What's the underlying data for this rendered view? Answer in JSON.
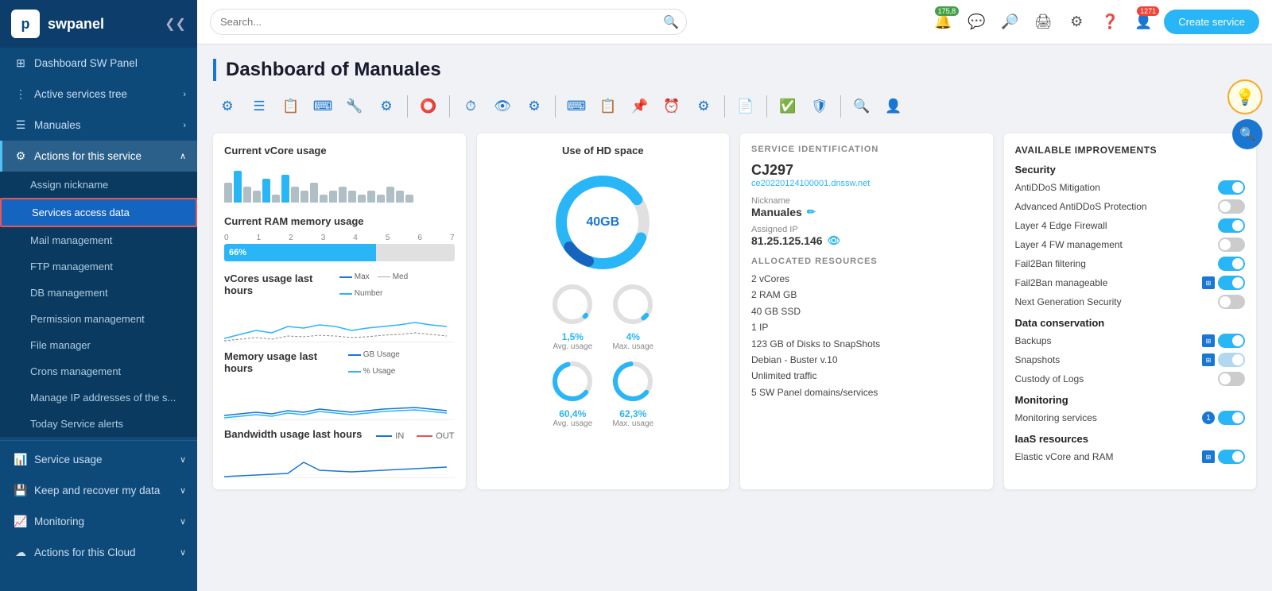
{
  "brand": {
    "logo_letter": "p",
    "name": "swpanel",
    "collapse_icon": "❮❮"
  },
  "sidebar": {
    "items": [
      {
        "id": "dashboard",
        "label": "Dashboard SW Panel",
        "icon": "⊞",
        "has_arrow": false
      },
      {
        "id": "active-services",
        "label": "Active services tree",
        "icon": "⋮",
        "has_arrow": true
      },
      {
        "id": "manuales",
        "label": "Manuales",
        "icon": "☰",
        "has_arrow": true,
        "expanded": true
      },
      {
        "id": "actions-service",
        "label": "Actions for this service",
        "icon": "⚙",
        "has_arrow": true,
        "active": true
      }
    ],
    "subitems": [
      {
        "id": "assign-nickname",
        "label": "Assign nickname"
      },
      {
        "id": "services-access-data",
        "label": "Services access data",
        "selected": true
      },
      {
        "id": "mail-management",
        "label": "Mail management"
      },
      {
        "id": "ftp-management",
        "label": "FTP management"
      },
      {
        "id": "db-management",
        "label": "DB management"
      },
      {
        "id": "permission-management",
        "label": "Permission management"
      },
      {
        "id": "file-manager",
        "label": "File manager"
      },
      {
        "id": "crons-management",
        "label": "Crons management"
      },
      {
        "id": "manage-ip",
        "label": "Manage IP addresses of the s..."
      },
      {
        "id": "today-alerts",
        "label": "Today Service alerts"
      }
    ],
    "bottom_items": [
      {
        "id": "service-usage",
        "label": "Service usage",
        "icon": "📊",
        "has_arrow": true
      },
      {
        "id": "keep-recover",
        "label": "Keep and recover my data",
        "icon": "💾",
        "has_arrow": true
      },
      {
        "id": "monitoring",
        "label": "Monitoring",
        "icon": "📈",
        "has_arrow": true
      },
      {
        "id": "actions-cloud",
        "label": "Actions for this Cloud",
        "icon": "☁",
        "has_arrow": true
      }
    ]
  },
  "topbar": {
    "search_placeholder": "Search...",
    "badges": {
      "green_count": "175,8",
      "red_count": "1271"
    },
    "create_btn": "Create service"
  },
  "page": {
    "title": "Dashboard of Manuales"
  },
  "toolbar": {
    "icons": [
      "⚙",
      "☰",
      "📋",
      "⌨",
      "🔧",
      "⚙",
      "⭕",
      "⏱",
      "👁",
      "⚙",
      "⌨",
      "📋",
      "📌",
      "⏰",
      "⚙",
      "📄",
      "✅",
      "🛡",
      "🔍",
      "👤"
    ]
  },
  "vcores": {
    "title": "Current vCore usage",
    "bars": [
      5,
      8,
      4,
      3,
      6,
      2,
      7,
      4,
      3,
      5,
      2,
      3,
      4,
      3,
      2,
      3,
      2,
      4,
      3,
      2
    ]
  },
  "ram": {
    "title": "Current RAM memory usage",
    "scale_labels": [
      "0",
      "1",
      "2",
      "3",
      "4",
      "5",
      "6",
      "7"
    ],
    "fill_percent": 66,
    "fill_label": "66%"
  },
  "vcores_last": {
    "title": "vCores usage last hours",
    "legend": [
      "Max",
      "Med",
      "Number"
    ]
  },
  "memory_last": {
    "title": "Memory usage last hours",
    "legend": [
      "GB Usage",
      "% Usage"
    ]
  },
  "hd_space": {
    "title": "Use of HD space",
    "total": "40GB",
    "used_pct": 85,
    "avg_label": "1,5%",
    "avg_sub": "Avg. usage",
    "max_label": "4%",
    "max_sub": "Max. usage",
    "avg2_label": "60,4%",
    "avg2_sub": "Avg. usage",
    "max2_label": "62,3%",
    "max2_sub": "Max. usage"
  },
  "service_id": {
    "section_title": "SERVICE IDENTIFICATION",
    "name": "CJ297",
    "domain": "ce20220124100001.dnssw.net",
    "nickname_label": "Nickname",
    "nickname_value": "Manuales",
    "ip_label": "Assigned IP",
    "ip_value": "81.25.125.146"
  },
  "alloc": {
    "section_title": "ALLOCATED RESOURCES",
    "items": [
      "2 vCores",
      "2 RAM GB",
      "40 GB SSD",
      "1 IP",
      "123 GB of Disks to SnapShots",
      "Debian - Buster v.10",
      "Unlimited traffic",
      "5 SW Panel domains/services"
    ]
  },
  "improvements": {
    "section_title": "AVAILABLE IMPROVEMENTS",
    "security": {
      "title": "Security",
      "items": [
        {
          "label": "AntiDDoS Mitigation",
          "state": "on",
          "has_grid": false
        },
        {
          "label": "Advanced AntiDDoS Protection",
          "state": "off",
          "has_grid": false
        },
        {
          "label": "Layer 4 Edge Firewall",
          "state": "on",
          "has_grid": false
        },
        {
          "label": "Layer 4 FW management",
          "state": "off",
          "has_grid": false
        },
        {
          "label": "Fail2Ban filtering",
          "state": "on",
          "has_grid": false
        },
        {
          "label": "Fail2Ban manageable",
          "state": "on",
          "has_grid": true
        },
        {
          "label": "Next Generation Security",
          "state": "off",
          "has_grid": false
        }
      ]
    },
    "data_conservation": {
      "title": "Data conservation",
      "items": [
        {
          "label": "Backups",
          "state": "on",
          "has_grid": true
        },
        {
          "label": "Snapshots",
          "state": "on",
          "has_grid": true
        },
        {
          "label": "Custody of Logs",
          "state": "off",
          "has_grid": false
        }
      ]
    },
    "monitoring": {
      "title": "Monitoring",
      "items": [
        {
          "label": "Monitoring services",
          "state": "on",
          "badge": "1",
          "has_grid": false
        }
      ]
    },
    "iaas": {
      "title": "IaaS resources",
      "items": [
        {
          "label": "Elastic vCore and RAM",
          "state": "on",
          "has_grid": true
        }
      ]
    }
  },
  "bandwidth": {
    "title": "Bandwidth usage last hours",
    "legend_in": "IN",
    "legend_out": "OUT"
  },
  "hints": {
    "bulb_icon": "💡",
    "search_icon": "🔍"
  }
}
